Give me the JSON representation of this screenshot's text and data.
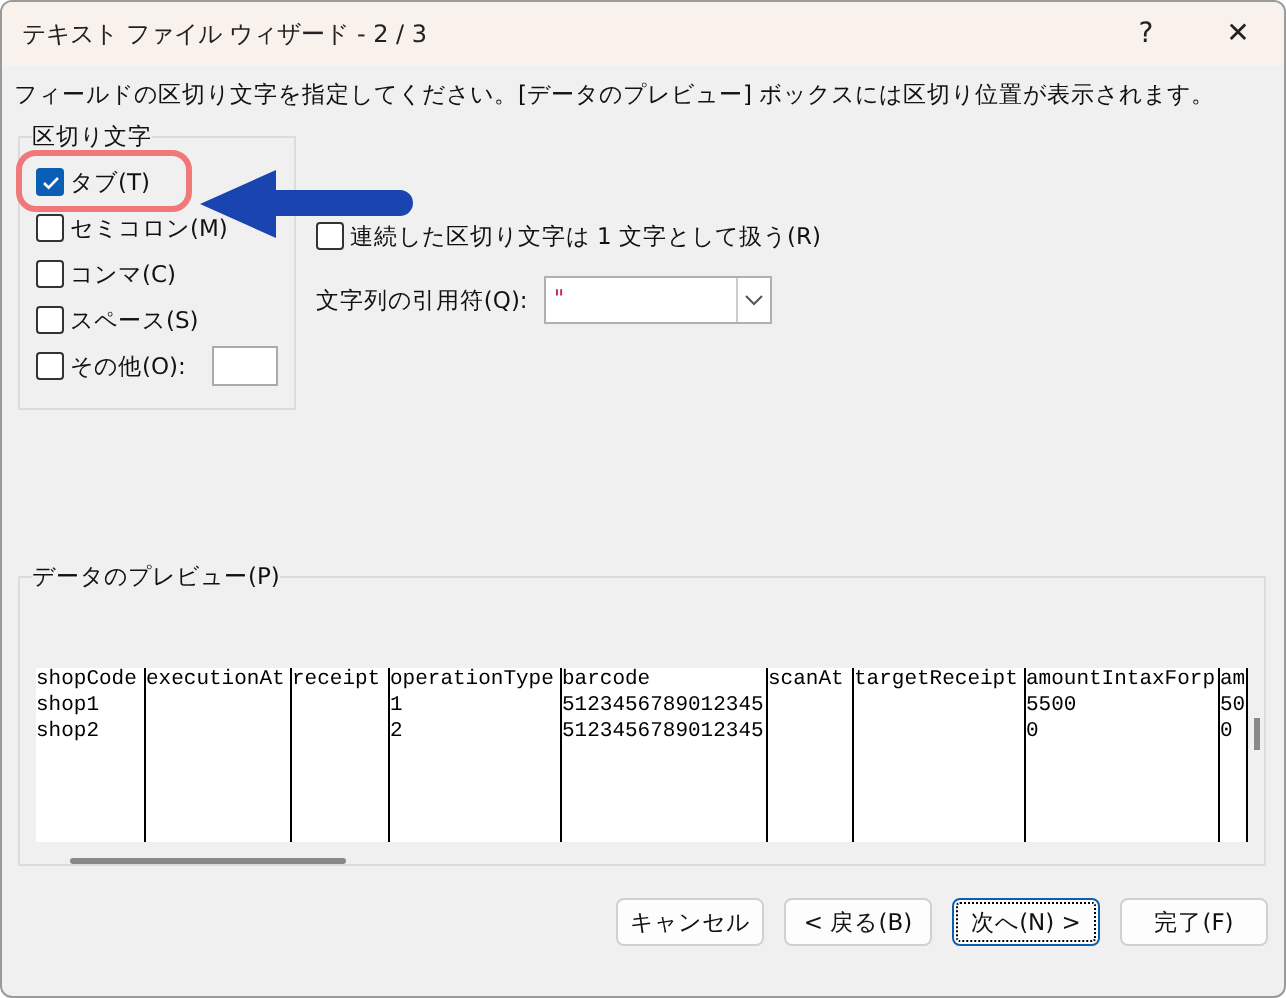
{
  "window": {
    "title": "テキスト ファイル ウィザード - 2 / 3",
    "help": "?",
    "close": "✕"
  },
  "instruction": "フィールドの区切り文字を指定してください。[データのプレビュー] ボックスには区切り位置が表示されます。",
  "delimiters": {
    "legend": "区切り文字",
    "items": [
      {
        "kind": "checkbox",
        "label": "タブ(T)",
        "checked": true,
        "highlighted": true
      },
      {
        "kind": "checkbox",
        "label": "セミコロン(M)",
        "checked": false,
        "highlighted": false
      },
      {
        "kind": "checkbox",
        "label": "コンマ(C)",
        "checked": false,
        "highlighted": false
      },
      {
        "kind": "checkbox",
        "label": "スペース(S)",
        "checked": false,
        "highlighted": false
      },
      {
        "kind": "other",
        "label": "その他(O):",
        "checked": false,
        "highlighted": false
      }
    ]
  },
  "consecutive": {
    "label": "連続した区切り文字は 1 文字として扱う(R)",
    "checked": false
  },
  "quote": {
    "label": "文字列の引用符(Q):",
    "value": "\""
  },
  "preview": {
    "legend": "データのプレビュー(P)",
    "columns": [
      "shopCode",
      "executionAt",
      "receipt",
      "operationType",
      "barcode",
      "scanAt",
      "targetReceipt",
      "amountIntaxForp",
      "am"
    ],
    "rows": [
      [
        "shop1",
        "",
        "",
        "1",
        "5123456789012345",
        "",
        "",
        "5500",
        "50"
      ],
      [
        "shop2",
        "",
        "",
        "2",
        "5123456789012345",
        "",
        "",
        "0",
        "0"
      ]
    ]
  },
  "buttons": [
    {
      "label": "キャンセル",
      "focused": false
    },
    {
      "label": "< 戻る(B)",
      "focused": false
    },
    {
      "label": "次へ(N) >",
      "focused": true
    },
    {
      "label": "完了(F)",
      "focused": false
    }
  ]
}
